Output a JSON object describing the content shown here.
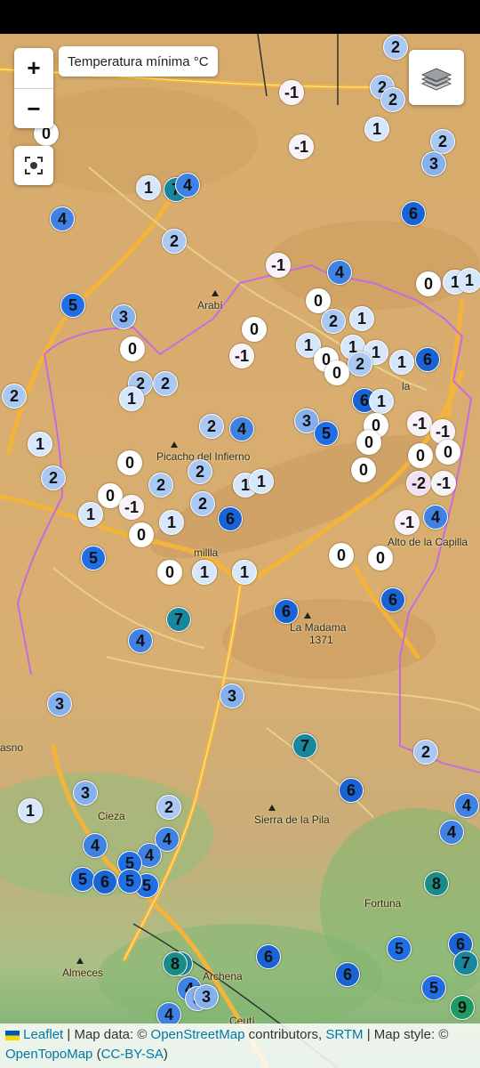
{
  "map": {
    "layer_title": "Temperatura mínima °C",
    "zoom_in_label": "+",
    "zoom_out_label": "−",
    "icons": {
      "locate": "locate-icon",
      "layers": "layers-icon",
      "flag": "ukraine-flag-icon"
    },
    "place_labels": [
      {
        "name": "arabi",
        "text": "Arabí"
      },
      {
        "name": "picacho",
        "text": "Picacho del Infierno"
      },
      {
        "name": "jumilla",
        "text": "millla"
      },
      {
        "name": "alto-capilla",
        "text": "Alto de la Capilla"
      },
      {
        "name": "la-madama",
        "text": "La Madama"
      },
      {
        "name": "la-madama-elev",
        "text": "1371"
      },
      {
        "name": "sierra-pila",
        "text": "Sierra de la Pila"
      },
      {
        "name": "cieza",
        "text": "Cieza"
      },
      {
        "name": "fortuna",
        "text": "Fortuna"
      },
      {
        "name": "almeces",
        "text": "Almeces"
      },
      {
        "name": "archena",
        "text": "Archena"
      },
      {
        "name": "yecla-fragment",
        "text": "la"
      },
      {
        "name": "calasparra-fragment",
        "text": "asno"
      },
      {
        "name": "ceuti",
        "text": "Ceutí"
      }
    ],
    "stations": [
      {
        "t": "2"
      },
      {
        "t": "2"
      },
      {
        "t": "2"
      },
      {
        "t": "-1"
      },
      {
        "t": "1"
      },
      {
        "t": "2"
      },
      {
        "t": "3"
      },
      {
        "t": "0"
      },
      {
        "t": "-1"
      },
      {
        "t": "1"
      },
      {
        "t": "7"
      },
      {
        "t": "4"
      },
      {
        "t": "4"
      },
      {
        "t": "6"
      },
      {
        "t": "2"
      },
      {
        "t": "-1"
      },
      {
        "t": "4"
      },
      {
        "t": "0"
      },
      {
        "t": "1"
      },
      {
        "t": "1"
      },
      {
        "t": "5"
      },
      {
        "t": "3"
      },
      {
        "t": "0"
      },
      {
        "t": "2"
      },
      {
        "t": "1"
      },
      {
        "t": "0"
      },
      {
        "t": "-1"
      },
      {
        "t": "0"
      },
      {
        "t": "1"
      },
      {
        "t": "0"
      },
      {
        "t": "1"
      },
      {
        "t": "1"
      },
      {
        "t": "2"
      },
      {
        "t": "0"
      },
      {
        "t": "6"
      },
      {
        "t": "1"
      },
      {
        "t": "2"
      },
      {
        "t": "2"
      },
      {
        "t": "1"
      },
      {
        "t": "6"
      },
      {
        "t": "3"
      },
      {
        "t": "5"
      },
      {
        "t": "1"
      },
      {
        "t": "2"
      },
      {
        "t": "4"
      },
      {
        "t": "-1"
      },
      {
        "t": "-1"
      },
      {
        "t": "0"
      },
      {
        "t": "0"
      },
      {
        "t": "0"
      },
      {
        "t": "0"
      },
      {
        "t": "2"
      },
      {
        "t": "2"
      },
      {
        "t": "1"
      },
      {
        "t": "-2"
      },
      {
        "t": "-1"
      },
      {
        "t": "0"
      },
      {
        "t": "2"
      },
      {
        "t": "2"
      },
      {
        "t": "1"
      },
      {
        "t": "1"
      },
      {
        "t": "0"
      },
      {
        "t": "-1"
      },
      {
        "t": "6"
      },
      {
        "t": "1"
      },
      {
        "t": "2"
      },
      {
        "t": "1"
      },
      {
        "t": "0"
      },
      {
        "t": "-1"
      },
      {
        "t": "4"
      },
      {
        "t": "5"
      },
      {
        "t": "0"
      },
      {
        "t": "0"
      },
      {
        "t": "1"
      },
      {
        "t": "1"
      },
      {
        "t": "0"
      },
      {
        "t": "0"
      },
      {
        "t": "7"
      },
      {
        "t": "6"
      },
      {
        "t": "6"
      },
      {
        "t": "4"
      },
      {
        "t": "3"
      },
      {
        "t": "3"
      },
      {
        "t": "7"
      },
      {
        "t": "2"
      },
      {
        "t": "3"
      },
      {
        "t": "6"
      },
      {
        "t": "1"
      },
      {
        "t": "2"
      },
      {
        "t": "4"
      },
      {
        "t": "4"
      },
      {
        "t": "5"
      },
      {
        "t": "4"
      },
      {
        "t": "4"
      },
      {
        "t": "4"
      },
      {
        "t": "5"
      },
      {
        "t": "6"
      },
      {
        "t": "5"
      },
      {
        "t": "5"
      },
      {
        "t": "8"
      },
      {
        "t": "7"
      },
      {
        "t": "8"
      },
      {
        "t": "6"
      },
      {
        "t": "6"
      },
      {
        "t": "5"
      },
      {
        "t": "4"
      },
      {
        "t": "3"
      },
      {
        "t": "5"
      },
      {
        "t": "6"
      },
      {
        "t": "7"
      },
      {
        "t": "9"
      },
      {
        "t": "4"
      },
      {
        "t": "3"
      }
    ]
  },
  "attribution": {
    "leaflet": "Leaflet",
    "sep1": " | Map data: © ",
    "osm": "OpenStreetMap",
    "contrib": " contributors, ",
    "srtm": "SRTM",
    "sep2": " | Map style: © ",
    "otm": "OpenTopoMap",
    "open_paren": " (",
    "license": "CC-BY-SA",
    "close_paren": ")"
  },
  "colors": {
    "temp_m2": "#f2dff0",
    "temp_m1": "#f7f1f8",
    "temp_0": "#ffffff",
    "temp_1": "#d6e6fb",
    "temp_2": "#a9c8f3",
    "temp_3": "#84b0ee",
    "temp_4": "#3f82e4",
    "temp_5": "#1f6ee6",
    "temp_6": "#1a63d4",
    "temp_7": "#18869c",
    "temp_8": "#1a8c86",
    "temp_9": "#1f9a62",
    "road": "#f3b43a",
    "boundary": "#c86be0"
  }
}
